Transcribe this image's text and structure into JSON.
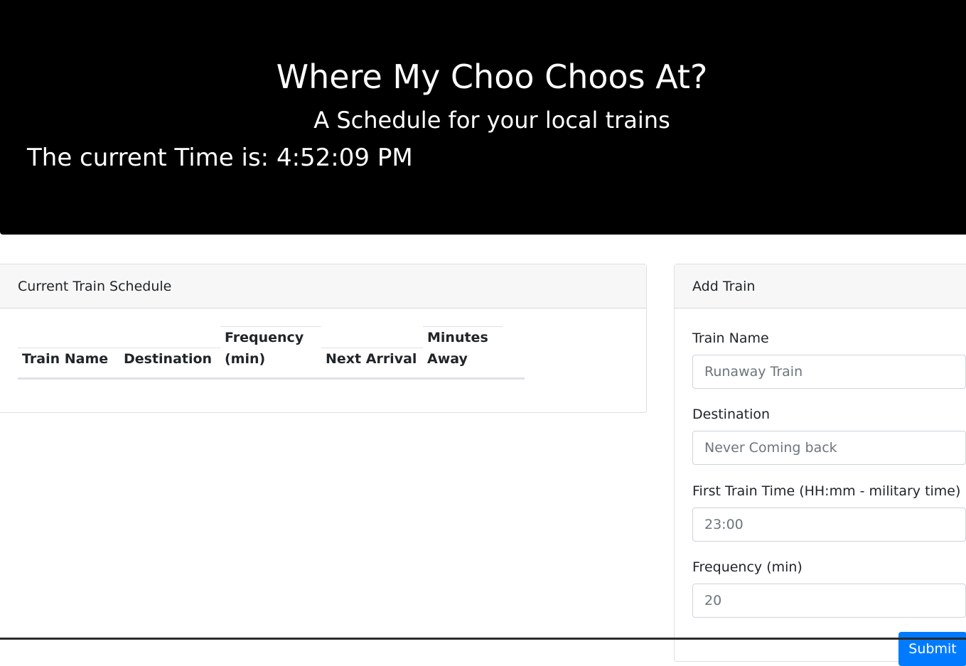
{
  "header": {
    "title": "Where My Choo Choos At?",
    "subtitle": "A Schedule for your local trains",
    "clock_text": "The current Time is: 4:52:09 PM"
  },
  "schedule": {
    "heading": "Current Train Schedule",
    "columns": [
      "Train Name",
      "Destination",
      "Frequency (min)",
      "Next Arrival",
      "Minutes Away"
    ],
    "rows": []
  },
  "add_train": {
    "heading": "Add Train",
    "fields": [
      {
        "label": "Train Name",
        "placeholder": "Runaway Train",
        "value": ""
      },
      {
        "label": "Destination",
        "placeholder": "Never Coming back",
        "value": ""
      },
      {
        "label": "First Train Time (HH:mm - military time)",
        "placeholder": "23:00",
        "value": ""
      },
      {
        "label": "Frequency (min)",
        "placeholder": "20",
        "value": ""
      }
    ],
    "submit_label": "Submit"
  },
  "colors": {
    "header_bg": "#000000",
    "header_text": "#ffffff",
    "card_header_bg": "#f7f7f7",
    "button_primary": "#007bff"
  }
}
